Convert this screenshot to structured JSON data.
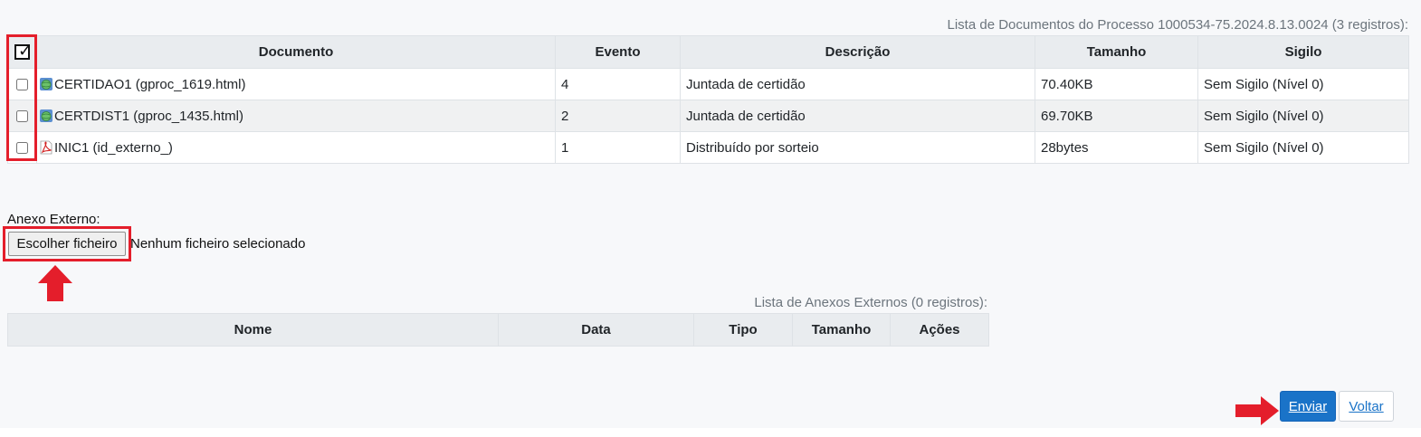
{
  "documents": {
    "caption": "Lista de Documentos do Processo 1000534-75.2024.8.13.0024 (3 registros):",
    "select_all_checked": true,
    "columns": [
      "Documento",
      "Evento",
      "Descrição",
      "Tamanho",
      "Sigilo"
    ],
    "rows": [
      {
        "icon": "html-document-icon",
        "documento": "CERTIDAO1 (gproc_1619.html)",
        "evento": "4",
        "descricao": "Juntada de certidão",
        "tamanho": "70.40KB",
        "sigilo": "Sem Sigilo (Nível 0)",
        "checked": false
      },
      {
        "icon": "html-document-icon",
        "documento": "CERTDIST1 (gproc_1435.html)",
        "evento": "2",
        "descricao": "Juntada de certidão",
        "tamanho": "69.70KB",
        "sigilo": "Sem Sigilo (Nível 0)",
        "checked": false
      },
      {
        "icon": "pdf-document-icon",
        "documento": "INIC1 (id_externo_)",
        "evento": "1",
        "descricao": "Distribuído por sorteio",
        "tamanho": "28bytes",
        "sigilo": "Sem Sigilo (Nível 0)",
        "checked": false
      }
    ]
  },
  "anexo_externo": {
    "label": "Anexo Externo:",
    "button_label": "Escolher ficheiro",
    "status": "Nenhum ficheiro selecionado"
  },
  "anexos": {
    "caption": "Lista de Anexos Externos (0 registros):",
    "columns": [
      "Nome",
      "Data",
      "Tipo",
      "Tamanho",
      "Ações"
    ]
  },
  "actions": {
    "enviar": "Enviar",
    "voltar": "Voltar"
  },
  "colors": {
    "highlight": "#e41e2b",
    "primary_button": "#1a73c8"
  }
}
